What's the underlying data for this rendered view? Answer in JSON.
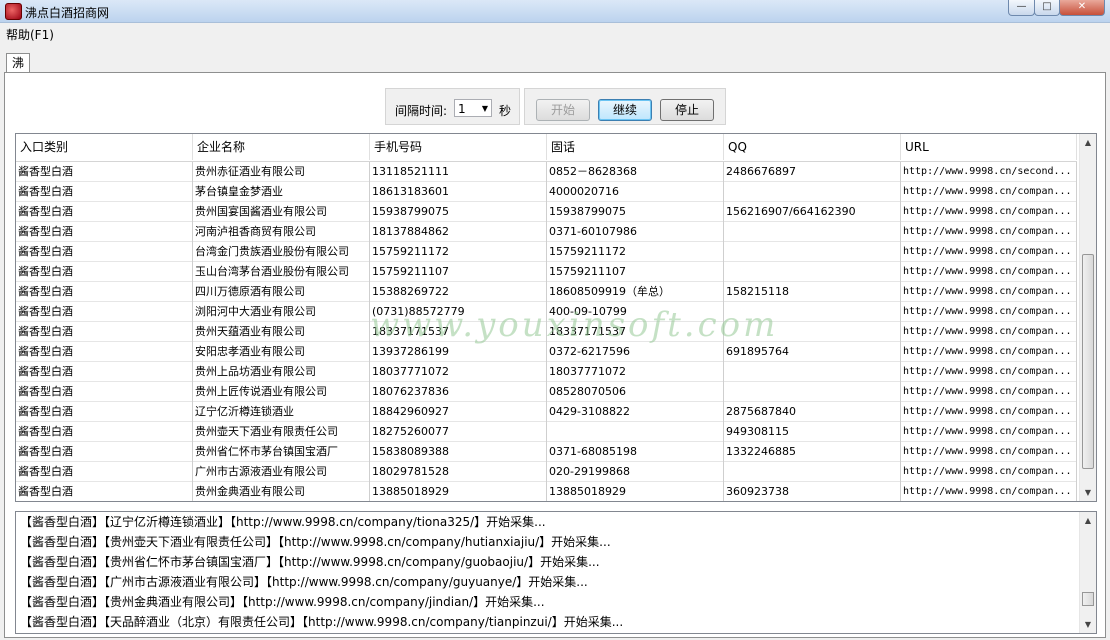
{
  "window": {
    "title": "沸点白酒招商网",
    "min_glyph": "—",
    "max_glyph": "□",
    "close_glyph": "✕"
  },
  "menu": {
    "help": "帮助(F1)"
  },
  "tab": {
    "label": "沸点白酒招商网"
  },
  "controls": {
    "interval_label": "间隔时间:",
    "interval_value": "1",
    "interval_unit": "秒",
    "start_label": "开始",
    "continue_label": "继续",
    "stop_label": "停止"
  },
  "table": {
    "headers": [
      "入口类别",
      "企业名称",
      "手机号码",
      "固话",
      "QQ",
      "URL"
    ],
    "rows": [
      [
        "酱香型白酒",
        "贵州赤征酒业有限公司",
        "13118521111",
        "0852－8628368",
        "2486676897",
        "http://www.9998.cn/second..."
      ],
      [
        "酱香型白酒",
        "茅台镇皇金梦酒业",
        "18613183601",
        "4000020716",
        "",
        "http://www.9998.cn/compan..."
      ],
      [
        "酱香型白酒",
        "贵州国宴国酱酒业有限公司",
        "15938799075",
        "15938799075",
        "156216907/664162390",
        "http://www.9998.cn/compan..."
      ],
      [
        "酱香型白酒",
        "河南泸祖香商贸有限公司",
        "18137884862",
        "0371-60107986",
        "",
        "http://www.9998.cn/compan..."
      ],
      [
        "酱香型白酒",
        "台湾金门贵族酒业股份有限公司",
        "15759211172",
        "15759211172",
        "",
        "http://www.9998.cn/compan..."
      ],
      [
        "酱香型白酒",
        "玉山台湾茅台酒业股份有限公司",
        "15759211107",
        "15759211107",
        "",
        "http://www.9998.cn/compan..."
      ],
      [
        "酱香型白酒",
        "四川万德原酒有限公司",
        "15388269722",
        "18608509919（牟总）",
        "158215118",
        "http://www.9998.cn/compan..."
      ],
      [
        "酱香型白酒",
        "浏阳河中大酒业有限公司",
        "(0731)88572779",
        "400-09-10799",
        "",
        "http://www.9998.cn/compan..."
      ],
      [
        "酱香型白酒",
        "贵州天蕴酒业有限公司",
        "18337171537",
        "18337171537",
        "",
        "http://www.9998.cn/compan..."
      ],
      [
        "酱香型白酒",
        "安阳忠孝酒业有限公司",
        "13937286199",
        "0372-6217596",
        "691895764",
        "http://www.9998.cn/compan..."
      ],
      [
        "酱香型白酒",
        "贵州上品坊酒业有限公司",
        "18037771072",
        "18037771072",
        "",
        "http://www.9998.cn/compan..."
      ],
      [
        "酱香型白酒",
        "贵州上匠传说酒业有限公司",
        "18076237836",
        "08528070506",
        "",
        "http://www.9998.cn/compan..."
      ],
      [
        "酱香型白酒",
        "辽宁亿沂樽连锁酒业",
        "18842960927",
        "0429-3108822",
        "2875687840",
        "http://www.9998.cn/compan..."
      ],
      [
        "酱香型白酒",
        "贵州壶天下酒业有限责任公司",
        "18275260077",
        "",
        "949308115",
        "http://www.9998.cn/compan..."
      ],
      [
        "酱香型白酒",
        "贵州省仁怀市茅台镇国宝酒厂",
        "15838089388",
        "0371-68085198",
        "1332246885",
        "http://www.9998.cn/compan..."
      ],
      [
        "酱香型白酒",
        "广州市古源液酒业有限公司",
        "18029781528",
        "020-29199868",
        "",
        "http://www.9998.cn/compan..."
      ],
      [
        "酱香型白酒",
        "贵州金典酒业有限公司",
        "13885018929",
        "13885018929",
        "360923738",
        "http://www.9998.cn/compan..."
      ]
    ]
  },
  "watermark": "www.youxinsoft.com",
  "log": [
    "【酱香型白酒】【辽宁亿沂樽连锁酒业】【http://www.9998.cn/company/tiona325/】开始采集...",
    "【酱香型白酒】【贵州壶天下酒业有限责任公司】【http://www.9998.cn/company/hutianxiajiu/】开始采集...",
    "【酱香型白酒】【贵州省仁怀市茅台镇国宝酒厂】【http://www.9998.cn/company/guobaojiu/】开始采集...",
    "【酱香型白酒】【广州市古源液酒业有限公司】【http://www.9998.cn/company/guyuanye/】开始采集...",
    "【酱香型白酒】【贵州金典酒业有限公司】【http://www.9998.cn/company/jindian/】开始采集...",
    "【酱香型白酒】【天品醉酒业（北京）有限责任公司】【http://www.9998.cn/company/tianpinzui/】开始采集..."
  ]
}
